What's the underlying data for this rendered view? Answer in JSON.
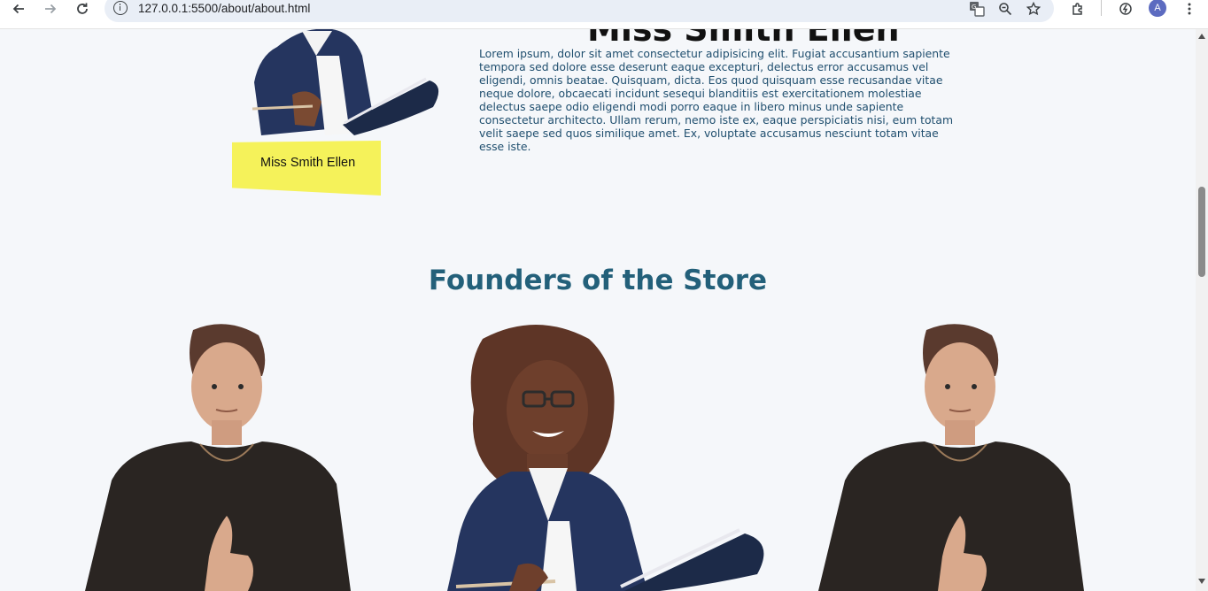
{
  "browser": {
    "url": "127.0.0.1:5500/about/about.html",
    "profile_initial": "A",
    "icons": [
      "back-icon",
      "forward-icon",
      "reload-icon",
      "site-info-icon",
      "translate-icon",
      "zoom-icon",
      "bookmark-star-icon",
      "extensions-icon",
      "performance-icon",
      "menu-icon"
    ]
  },
  "hero": {
    "name_heading": "Miss Smith Ellen",
    "bio": "Lorem ipsum, dolor sit amet consectetur adipisicing elit. Fugiat accusantium sapiente tempora sed dolore esse deserunt eaque excepturi, delectus error accusamus vel eligendi, omnis beatae. Quisquam, dicta. Eos quod quisquam esse recusandae vitae neque dolore, obcaecati incidunt sesequi blanditiis est exercitationem molestiae delectus saepe odio eligendi modi porro eaque in libero minus unde sapiente consectetur architecto. Ullam rerum, nemo iste ex, eaque perspiciatis nisi, eum totam velit saepe sed quos similique amet. Ex, voluptate accusamus nesciunt totam vitae esse iste.",
    "name_tag": "Miss Smith Ellen",
    "tag_color": "#f5f25a"
  },
  "founders": {
    "title": "Founders of the Store",
    "title_color": "#23607a"
  },
  "colors": {
    "page_bg": "#f5f7fa",
    "bio_text": "#1f4e6e"
  }
}
